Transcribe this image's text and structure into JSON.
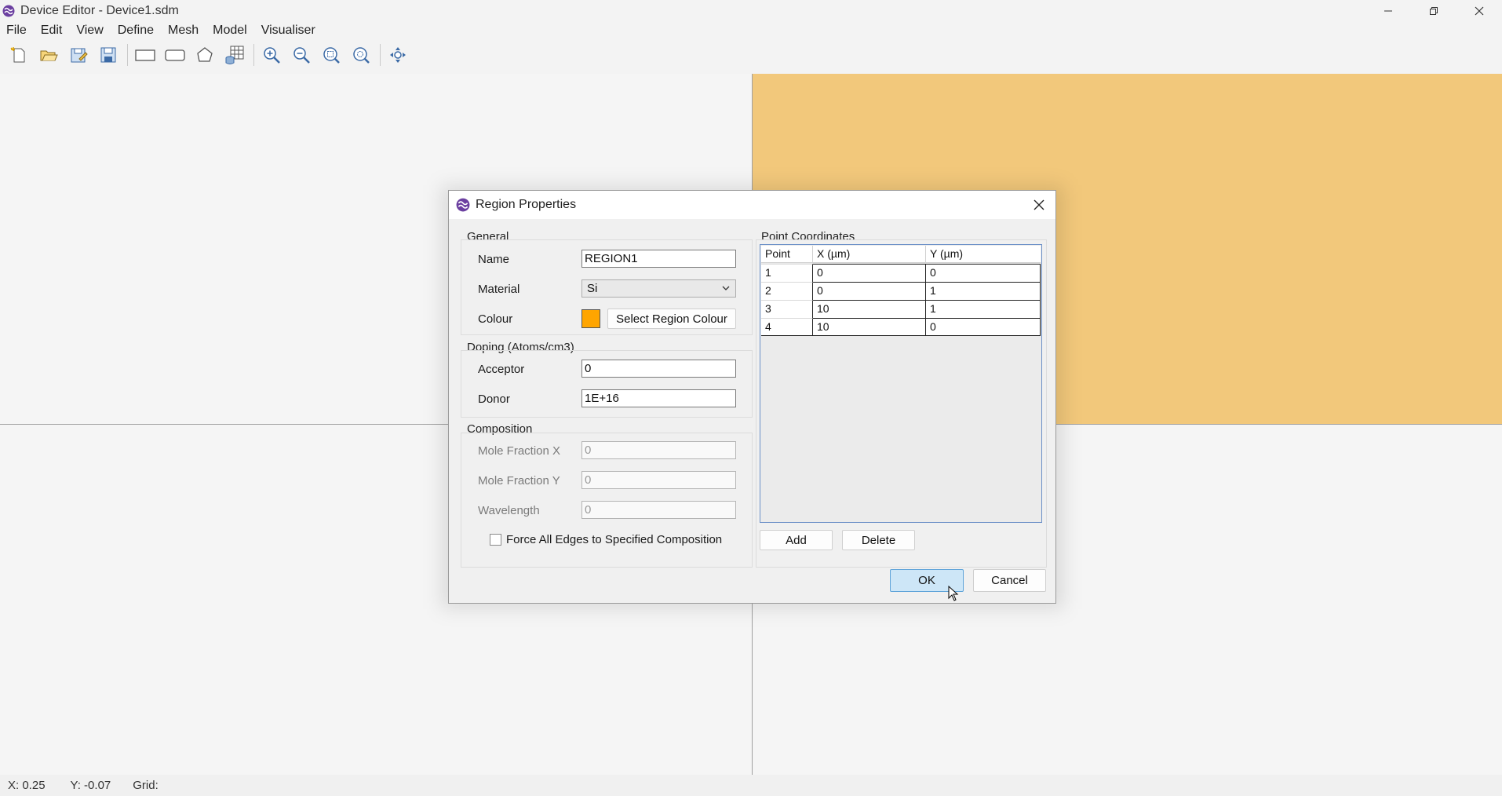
{
  "window": {
    "title": "Device Editor - Device1.sdm",
    "minimize_icon": "minimize-icon",
    "maximize_icon": "restore-icon",
    "close_icon": "close-icon"
  },
  "menu": [
    "File",
    "Edit",
    "View",
    "Define",
    "Mesh",
    "Model",
    "Visualiser"
  ],
  "toolbar": {
    "icons": [
      "new-file-icon",
      "open-folder-icon",
      "save-as-icon",
      "save-icon",
      "rectangle-tool-icon",
      "rounded-rectangle-tool-icon",
      "polygon-tool-icon",
      "table-tool-icon",
      "zoom-in-icon",
      "zoom-out-icon",
      "zoom-fit-icon",
      "zoom-region-icon",
      "pan-icon"
    ]
  },
  "canvas": {
    "region_color": "#f2c87b"
  },
  "status": {
    "x": "X: 0.25",
    "y": "Y: -0.07",
    "grid": "Grid:"
  },
  "dialog": {
    "title": "Region Properties",
    "general": {
      "group": "General",
      "name_label": "Name",
      "name_value": "REGION1",
      "material_label": "Material",
      "material_value": "Si",
      "colour_label": "Colour",
      "colour_value": "#ffa500",
      "select_colour_button": "Select Region Colour"
    },
    "doping": {
      "group": "Doping (Atoms/cm3)",
      "acceptor_label": "Acceptor",
      "acceptor_value": "0",
      "donor_label": "Donor",
      "donor_value": "1E+16"
    },
    "composition": {
      "group": "Composition",
      "mole_x_label": "Mole Fraction X",
      "mole_x_value": "0",
      "mole_y_label": "Mole Fraction Y",
      "mole_y_value": "0",
      "wavelength_label": "Wavelength",
      "wavelength_value": "0",
      "force_edges_label": "Force All Edges to Specified Composition"
    },
    "points": {
      "group": "Point Coordinates",
      "headers": [
        "Point",
        "X (µm)",
        "Y (µm)"
      ],
      "rows": [
        [
          "1",
          "0",
          "0"
        ],
        [
          "2",
          "0",
          "1"
        ],
        [
          "3",
          "10",
          "1"
        ],
        [
          "4",
          "10",
          "0"
        ]
      ],
      "add_button": "Add",
      "delete_button": "Delete"
    },
    "ok_button": "OK",
    "cancel_button": "Cancel"
  }
}
